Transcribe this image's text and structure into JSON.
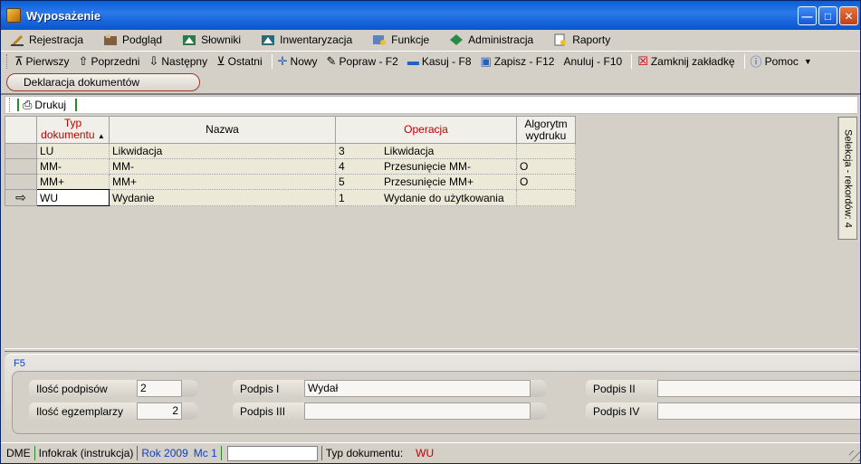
{
  "window": {
    "title": "Wyposażenie"
  },
  "menu": [
    {
      "label": "Rejestracja",
      "icon": "pen-icon"
    },
    {
      "label": "Podgląd",
      "icon": "preview-icon"
    },
    {
      "label": "Słowniki",
      "icon": "dictionary-icon"
    },
    {
      "label": "Inwentaryzacja",
      "icon": "inventory-icon"
    },
    {
      "label": "Funkcje",
      "icon": "functions-icon"
    },
    {
      "label": "Administracja",
      "icon": "admin-icon"
    },
    {
      "label": "Raporty",
      "icon": "reports-icon"
    }
  ],
  "toolbar": {
    "first": "Pierwszy",
    "prev": "Poprzedni",
    "next": "Następny",
    "last": "Ostatni",
    "new": "Nowy",
    "edit": "Popraw - F2",
    "delete": "Kasuj - F8",
    "save": "Zapisz - F12",
    "cancel": "Anuluj - F10",
    "close_tab": "Zamknij zakładkę",
    "help": "Pomoc"
  },
  "tab": {
    "label": "Deklaracja dokumentów"
  },
  "subtoolbar": {
    "print": "Drukuj"
  },
  "grid": {
    "columns": {
      "typ": "Typ dokumentu",
      "nazwa": "Nazwa",
      "operacja": "Operacja",
      "algorytm": "Algorytm wydruku"
    },
    "rows": [
      {
        "typ": "LU",
        "nazwa": "Likwidacja",
        "op_num": "3",
        "op_name": "Likwidacja",
        "algorytm": ""
      },
      {
        "typ": "MM-",
        "nazwa": "MM-",
        "op_num": "4",
        "op_name": "Przesunięcie MM-",
        "algorytm": "O"
      },
      {
        "typ": "MM+",
        "nazwa": "MM+",
        "op_num": "5",
        "op_name": "Przesunięcie MM+",
        "algorytm": "O"
      },
      {
        "typ": "WU",
        "nazwa": "Wydanie",
        "op_num": "1",
        "op_name": "Wydanie do użytkowania",
        "algorytm": ""
      }
    ],
    "current_row": 3
  },
  "side_tab": {
    "label": "Selekcja - rekordów: 4"
  },
  "panel": {
    "label": "F5",
    "ilosc_podpisow_label": "Ilość podpisów",
    "ilosc_podpisow_value": "2",
    "ilosc_egz_label": "Ilość egzemplarzy",
    "ilosc_egz_value": "2",
    "podpis1_label": "Podpis I",
    "podpis1_value": "Wydał",
    "podpis2_label": "Podpis II",
    "podpis2_value": "",
    "podpis3_label": "Podpis III",
    "podpis3_value": "",
    "podpis4_label": "Podpis IV",
    "podpis4_value": ""
  },
  "status": {
    "db": "DME",
    "user": "Infokrak (instrukcja)",
    "year": "Rok 2009",
    "month": "Mc 1",
    "input": "",
    "doc_type_label": "Typ dokumentu:",
    "doc_type_value": "WU"
  },
  "colors": {
    "title_blue": "#0a5fd8",
    "accent_red": "#c00000",
    "status_blue": "#1040c0"
  }
}
